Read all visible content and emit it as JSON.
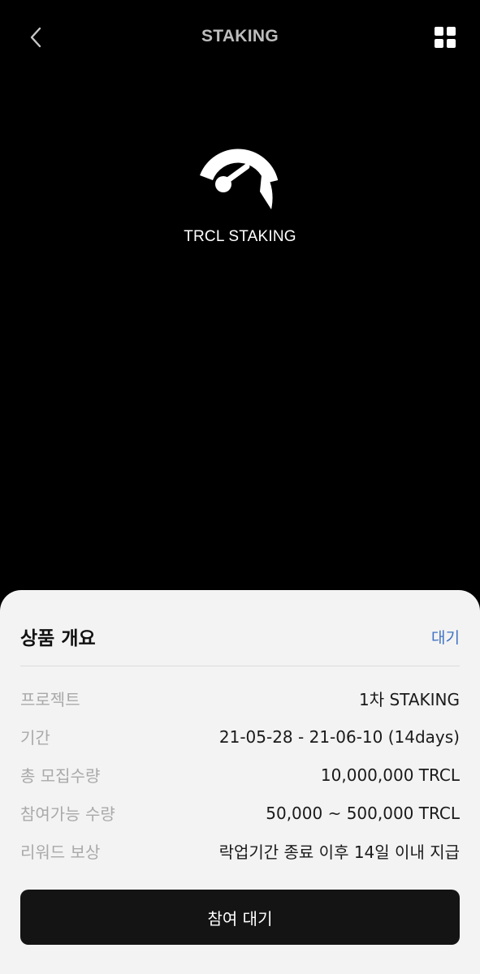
{
  "header": {
    "title": "STAKING",
    "back_icon": "chevron-left-icon",
    "menu_icon": "grid-icon"
  },
  "hero": {
    "icon": "gauge-icon",
    "label": "TRCL STAKING"
  },
  "sheet": {
    "title": "상품 개요",
    "status": "대기",
    "rows": [
      {
        "label": "프로젝트",
        "value": "1차 STAKING"
      },
      {
        "label": "기간",
        "value": "21-05-28 - 21-06-10 (14days)"
      },
      {
        "label": "총 모집수량",
        "value": "10,000,000 TRCL"
      },
      {
        "label": "참여가능 수량",
        "value": "50,000 ~ 500,000 TRCL"
      },
      {
        "label": "리워드 보상",
        "value": "락업기간 종료 이후 14일 이내 지급"
      }
    ],
    "button_label": "참여 대기"
  },
  "colors": {
    "background": "#000000",
    "sheet": "#f3f3f3",
    "status_accent": "#3f72c4",
    "button": "#141414"
  }
}
